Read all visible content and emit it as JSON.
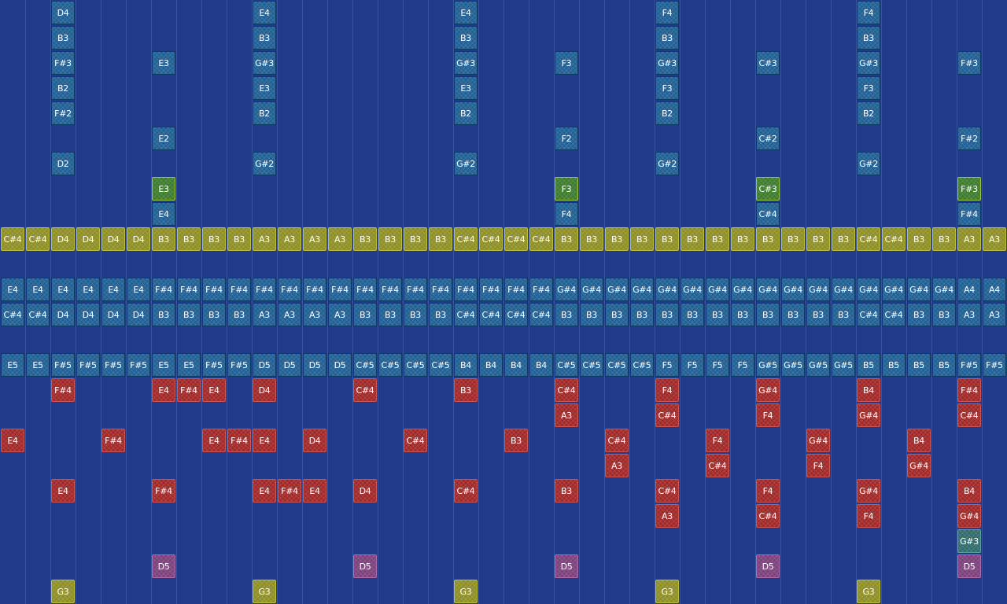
{
  "colors": {
    "background": "#213a8a",
    "blue_note": "#1c5d92",
    "green_note": "#3a7a2a",
    "yellow_note": "#8c8c22",
    "red_note": "#a02525",
    "pink_note": "#7a3e7a",
    "teal_note": "#2f6a6a"
  },
  "grid": {
    "columns": 40,
    "rows": 24
  },
  "notes": [
    {
      "label": "D4",
      "col": 2,
      "row": 0,
      "color": "blue"
    },
    {
      "label": "E4",
      "col": 10,
      "row": 0,
      "color": "blue"
    },
    {
      "label": "E4",
      "col": 18,
      "row": 0,
      "color": "blue"
    },
    {
      "label": "F4",
      "col": 26,
      "row": 0,
      "color": "blue"
    },
    {
      "label": "F4",
      "col": 34,
      "row": 0,
      "color": "blue"
    },
    {
      "label": "B3",
      "col": 2,
      "row": 1,
      "color": "blue"
    },
    {
      "label": "B3",
      "col": 10,
      "row": 1,
      "color": "blue"
    },
    {
      "label": "B3",
      "col": 18,
      "row": 1,
      "color": "blue"
    },
    {
      "label": "B3",
      "col": 26,
      "row": 1,
      "color": "blue"
    },
    {
      "label": "B3",
      "col": 34,
      "row": 1,
      "color": "blue"
    },
    {
      "label": "F#3",
      "col": 2,
      "row": 2,
      "color": "blue"
    },
    {
      "label": "E3",
      "col": 6,
      "row": 2,
      "color": "blue"
    },
    {
      "label": "G#3",
      "col": 10,
      "row": 2,
      "color": "blue"
    },
    {
      "label": "G#3",
      "col": 18,
      "row": 2,
      "color": "blue"
    },
    {
      "label": "F3",
      "col": 22,
      "row": 2,
      "color": "blue"
    },
    {
      "label": "G#3",
      "col": 26,
      "row": 2,
      "color": "blue"
    },
    {
      "label": "C#3",
      "col": 30,
      "row": 2,
      "color": "blue"
    },
    {
      "label": "G#3",
      "col": 34,
      "row": 2,
      "color": "blue"
    },
    {
      "label": "F#3",
      "col": 38,
      "row": 2,
      "color": "blue"
    },
    {
      "label": "B2",
      "col": 2,
      "row": 3,
      "color": "blue"
    },
    {
      "label": "E3",
      "col": 10,
      "row": 3,
      "color": "blue"
    },
    {
      "label": "E3",
      "col": 18,
      "row": 3,
      "color": "blue"
    },
    {
      "label": "F3",
      "col": 26,
      "row": 3,
      "color": "blue"
    },
    {
      "label": "F3",
      "col": 34,
      "row": 3,
      "color": "blue"
    },
    {
      "label": "F#2",
      "col": 2,
      "row": 4,
      "color": "blue"
    },
    {
      "label": "B2",
      "col": 10,
      "row": 4,
      "color": "blue"
    },
    {
      "label": "B2",
      "col": 18,
      "row": 4,
      "color": "blue"
    },
    {
      "label": "B2",
      "col": 26,
      "row": 4,
      "color": "blue"
    },
    {
      "label": "B2",
      "col": 34,
      "row": 4,
      "color": "blue"
    },
    {
      "label": "E2",
      "col": 6,
      "row": 5,
      "color": "blue"
    },
    {
      "label": "F2",
      "col": 22,
      "row": 5,
      "color": "blue"
    },
    {
      "label": "C#2",
      "col": 30,
      "row": 5,
      "color": "blue"
    },
    {
      "label": "F#2",
      "col": 38,
      "row": 5,
      "color": "blue"
    },
    {
      "label": "D2",
      "col": 2,
      "row": 6,
      "color": "blue"
    },
    {
      "label": "G#2",
      "col": 10,
      "row": 6,
      "color": "blue"
    },
    {
      "label": "G#2",
      "col": 18,
      "row": 6,
      "color": "blue"
    },
    {
      "label": "G#2",
      "col": 26,
      "row": 6,
      "color": "blue"
    },
    {
      "label": "G#2",
      "col": 34,
      "row": 6,
      "color": "blue"
    },
    {
      "label": "E3",
      "col": 6,
      "row": 7,
      "color": "green"
    },
    {
      "label": "F3",
      "col": 22,
      "row": 7,
      "color": "green"
    },
    {
      "label": "C#3",
      "col": 30,
      "row": 7,
      "color": "green"
    },
    {
      "label": "F#3",
      "col": 38,
      "row": 7,
      "color": "green"
    },
    {
      "label": "E4",
      "col": 6,
      "row": 8,
      "color": "blue"
    },
    {
      "label": "F4",
      "col": 22,
      "row": 8,
      "color": "blue"
    },
    {
      "label": "C#4",
      "col": 30,
      "row": 8,
      "color": "blue"
    },
    {
      "label": "F#4",
      "col": 38,
      "row": 8,
      "color": "blue"
    },
    {
      "label": "F#4",
      "col": 2,
      "row": 15,
      "color": "red"
    },
    {
      "label": "E4",
      "col": 6,
      "row": 15,
      "color": "red"
    },
    {
      "label": "F#4",
      "col": 7,
      "row": 15,
      "color": "red"
    },
    {
      "label": "E4",
      "col": 8,
      "row": 15,
      "color": "red"
    },
    {
      "label": "D4",
      "col": 10,
      "row": 15,
      "color": "red"
    },
    {
      "label": "C#4",
      "col": 14,
      "row": 15,
      "color": "red"
    },
    {
      "label": "B3",
      "col": 18,
      "row": 15,
      "color": "red"
    },
    {
      "label": "C#4",
      "col": 22,
      "row": 15,
      "color": "red"
    },
    {
      "label": "F4",
      "col": 26,
      "row": 15,
      "color": "red"
    },
    {
      "label": "G#4",
      "col": 30,
      "row": 15,
      "color": "red"
    },
    {
      "label": "B4",
      "col": 34,
      "row": 15,
      "color": "red"
    },
    {
      "label": "F#4",
      "col": 38,
      "row": 15,
      "color": "red"
    },
    {
      "label": "A3",
      "col": 22,
      "row": 16,
      "color": "red"
    },
    {
      "label": "C#4",
      "col": 26,
      "row": 16,
      "color": "red"
    },
    {
      "label": "F4",
      "col": 30,
      "row": 16,
      "color": "red"
    },
    {
      "label": "G#4",
      "col": 34,
      "row": 16,
      "color": "red"
    },
    {
      "label": "C#4",
      "col": 38,
      "row": 16,
      "color": "red"
    },
    {
      "label": "E4",
      "col": 0,
      "row": 17,
      "color": "red"
    },
    {
      "label": "F#4",
      "col": 4,
      "row": 17,
      "color": "red"
    },
    {
      "label": "E4",
      "col": 8,
      "row": 17,
      "color": "red"
    },
    {
      "label": "F#4",
      "col": 9,
      "row": 17,
      "color": "red"
    },
    {
      "label": "E4",
      "col": 10,
      "row": 17,
      "color": "red"
    },
    {
      "label": "D4",
      "col": 12,
      "row": 17,
      "color": "red"
    },
    {
      "label": "C#4",
      "col": 16,
      "row": 17,
      "color": "red"
    },
    {
      "label": "B3",
      "col": 20,
      "row": 17,
      "color": "red"
    },
    {
      "label": "C#4",
      "col": 24,
      "row": 17,
      "color": "red"
    },
    {
      "label": "F4",
      "col": 28,
      "row": 17,
      "color": "red"
    },
    {
      "label": "G#4",
      "col": 32,
      "row": 17,
      "color": "red"
    },
    {
      "label": "B4",
      "col": 36,
      "row": 17,
      "color": "red"
    },
    {
      "label": "A3",
      "col": 24,
      "row": 18,
      "color": "red"
    },
    {
      "label": "C#4",
      "col": 28,
      "row": 18,
      "color": "red"
    },
    {
      "label": "F4",
      "col": 32,
      "row": 18,
      "color": "red"
    },
    {
      "label": "G#4",
      "col": 36,
      "row": 18,
      "color": "red"
    },
    {
      "label": "E4",
      "col": 2,
      "row": 19,
      "color": "red"
    },
    {
      "label": "F#4",
      "col": 6,
      "row": 19,
      "color": "red"
    },
    {
      "label": "E4",
      "col": 10,
      "row": 19,
      "color": "red"
    },
    {
      "label": "F#4",
      "col": 11,
      "row": 19,
      "color": "red"
    },
    {
      "label": "E4",
      "col": 12,
      "row": 19,
      "color": "red"
    },
    {
      "label": "D4",
      "col": 14,
      "row": 19,
      "color": "red"
    },
    {
      "label": "C#4",
      "col": 18,
      "row": 19,
      "color": "red"
    },
    {
      "label": "B3",
      "col": 22,
      "row": 19,
      "color": "red"
    },
    {
      "label": "C#4",
      "col": 26,
      "row": 19,
      "color": "red"
    },
    {
      "label": "F4",
      "col": 30,
      "row": 19,
      "color": "red"
    },
    {
      "label": "G#4",
      "col": 34,
      "row": 19,
      "color": "red"
    },
    {
      "label": "B4",
      "col": 38,
      "row": 19,
      "color": "red"
    },
    {
      "label": "A3",
      "col": 26,
      "row": 20,
      "color": "red"
    },
    {
      "label": "C#4",
      "col": 30,
      "row": 20,
      "color": "red"
    },
    {
      "label": "F4",
      "col": 34,
      "row": 20,
      "color": "red"
    },
    {
      "label": "G#4",
      "col": 38,
      "row": 20,
      "color": "red"
    },
    {
      "label": "G#3",
      "col": 38,
      "row": 21,
      "color": "teal"
    },
    {
      "label": "D5",
      "col": 6,
      "row": 22,
      "color": "pink"
    },
    {
      "label": "D5",
      "col": 14,
      "row": 22,
      "color": "pink"
    },
    {
      "label": "D5",
      "col": 22,
      "row": 22,
      "color": "pink"
    },
    {
      "label": "D5",
      "col": 30,
      "row": 22,
      "color": "pink"
    },
    {
      "label": "D5",
      "col": 38,
      "row": 22,
      "color": "pink"
    },
    {
      "label": "G3",
      "col": 2,
      "row": 23,
      "color": "yellow"
    },
    {
      "label": "G3",
      "col": 10,
      "row": 23,
      "color": "yellow"
    },
    {
      "label": "G3",
      "col": 18,
      "row": 23,
      "color": "yellow"
    },
    {
      "label": "G3",
      "col": 26,
      "row": 23,
      "color": "yellow"
    },
    {
      "label": "G3",
      "col": 34,
      "row": 23,
      "color": "yellow"
    }
  ],
  "rows": [
    {
      "row": 9,
      "color": "yellow",
      "labels": [
        "C#4",
        "C#4",
        "D4",
        "D4",
        "D4",
        "D4",
        "B3",
        "B3",
        "B3",
        "B3",
        "A3",
        "A3",
        "A3",
        "A3",
        "B3",
        "B3",
        "B3",
        "B3",
        "C#4",
        "C#4",
        "C#4",
        "C#4",
        "B3",
        "B3",
        "B3",
        "B3",
        "B3",
        "B3",
        "B3",
        "B3",
        "B3",
        "B3",
        "B3",
        "B3",
        "C#4",
        "C#4",
        "B3",
        "B3",
        "A3",
        "A3"
      ]
    },
    {
      "row": 11,
      "color": "blue",
      "labels": [
        "E4",
        "E4",
        "E4",
        "E4",
        "E4",
        "E4",
        "F#4",
        "F#4",
        "F#4",
        "F#4",
        "F#4",
        "F#4",
        "F#4",
        "F#4",
        "F#4",
        "F#4",
        "F#4",
        "F#4",
        "F#4",
        "F#4",
        "F#4",
        "F#4",
        "G#4",
        "G#4",
        "G#4",
        "G#4",
        "G#4",
        "G#4",
        "G#4",
        "G#4",
        "G#4",
        "G#4",
        "G#4",
        "G#4",
        "G#4",
        "G#4",
        "G#4",
        "G#4",
        "A4",
        "A4"
      ]
    },
    {
      "row": 12,
      "color": "blue",
      "labels": [
        "C#4",
        "C#4",
        "D4",
        "D4",
        "D4",
        "D4",
        "B3",
        "B3",
        "B3",
        "B3",
        "A3",
        "A3",
        "A3",
        "A3",
        "B3",
        "B3",
        "B3",
        "B3",
        "C#4",
        "C#4",
        "C#4",
        "C#4",
        "B3",
        "B3",
        "B3",
        "B3",
        "B3",
        "B3",
        "B3",
        "B3",
        "B3",
        "B3",
        "B3",
        "B3",
        "C#4",
        "C#4",
        "B3",
        "B3",
        "A3",
        "A3"
      ]
    },
    {
      "row": 14,
      "color": "blue",
      "labels": [
        "E5",
        "E5",
        "F#5",
        "F#5",
        "F#5",
        "F#5",
        "E5",
        "E5",
        "F#5",
        "F#5",
        "D5",
        "D5",
        "D5",
        "D5",
        "C#5",
        "C#5",
        "C#5",
        "C#5",
        "B4",
        "B4",
        "B4",
        "B4",
        "C#5",
        "C#5",
        "C#5",
        "C#5",
        "F5",
        "F5",
        "F5",
        "F5",
        "G#5",
        "G#5",
        "G#5",
        "G#5",
        "B5",
        "B5",
        "B5",
        "B5",
        "F#5",
        "F#5"
      ]
    }
  ]
}
